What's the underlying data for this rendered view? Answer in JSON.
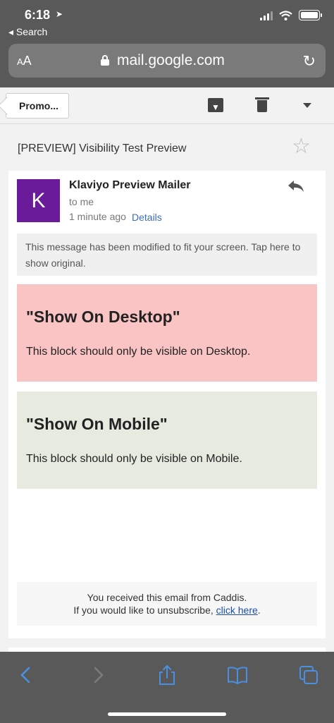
{
  "status_bar": {
    "time": "6:18",
    "back_label": "◂ Search"
  },
  "browser": {
    "text_size_label": "AA",
    "url": "mail.google.com"
  },
  "toolbar": {
    "label_button": "Promo..."
  },
  "email": {
    "subject": "[PREVIEW] Visibility Test Preview",
    "sender_initial": "K",
    "avatar_color": "#6a1b9a",
    "sender_name": "Klaviyo Preview Mailer",
    "recipient": "to me",
    "timestamp": "1 minute ago",
    "details_link": "Details",
    "notice": "This message has been modified to fit your screen. Tap here to show original.",
    "blocks": [
      {
        "heading": "\"Show On Desktop\"",
        "text": "This block should only be visible on Desktop.",
        "color": "#fbc4c4"
      },
      {
        "heading": "\"Show On Mobile\"",
        "text": "This block should only be visible on Mobile.",
        "color": "#e7ebdf"
      }
    ],
    "footer": {
      "line1": "You received this email from Caddis.",
      "line2_prefix": "If you would like to unsubscribe,",
      "link": "click here",
      "line2_suffix": "."
    }
  },
  "icons": {
    "location": "location-arrow-icon",
    "signal": "cellular-signal-icon",
    "wifi": "wifi-icon",
    "battery": "battery-icon",
    "lock": "lock-icon",
    "reload": "reload-icon",
    "archive": "archive-icon",
    "trash": "trash-icon",
    "more": "chevron-down-icon",
    "star": "star-icon",
    "reply": "reply-icon",
    "back": "back-chevron-icon",
    "forward": "forward-chevron-icon",
    "share": "share-icon",
    "bookmarks": "book-icon",
    "tabs": "tabs-icon"
  }
}
